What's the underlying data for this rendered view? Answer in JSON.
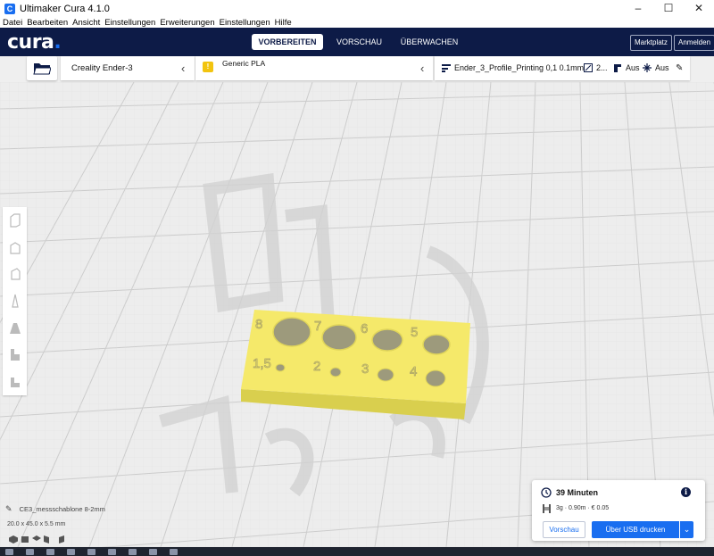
{
  "window": {
    "title": "Ultimaker Cura 4.1.0"
  },
  "menu": [
    "Datei",
    "Bearbeiten",
    "Ansicht",
    "Einstellungen",
    "Erweiterungen",
    "Einstellungen",
    "Hilfe"
  ],
  "header": {
    "logo": "cura",
    "tabs": [
      "VORBEREITEN",
      "VORSCHAU",
      "ÜBERWACHEN"
    ],
    "active_tab": "VORBEREITEN",
    "marketplace": "Marktplatz",
    "login": "Anmelden"
  },
  "toolbar": {
    "printer": "Creality Ender-3",
    "material": "Generic PLA",
    "profile": "Ender_3_Profile_Printing 0,1 0.1mm",
    "infill": "2...",
    "support": "Aus",
    "adhesion": "Aus"
  },
  "model": {
    "labels": [
      "8",
      "7",
      "6",
      "5",
      "1,5",
      "2",
      "3",
      "4"
    ],
    "file_name": "CE3_messschablone 8-2mm",
    "dimensions": "20.0 x 45.0 x 5.5 mm",
    "color": "#f5e96a"
  },
  "print_panel": {
    "time": "39 Minuten",
    "usage": "3g · 0.90m · € 0.05",
    "preview_button": "Vorschau",
    "print_button": "Über USB drucken"
  },
  "colors": {
    "header": "#0d1b47",
    "accent": "#196ef0"
  }
}
